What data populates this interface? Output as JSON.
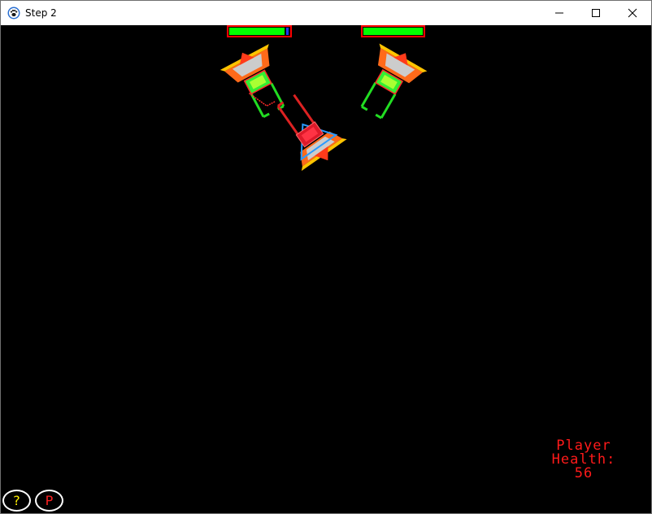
{
  "window": {
    "title": "Step 2",
    "controls": [
      "minimize",
      "maximize",
      "close"
    ]
  },
  "hud": {
    "player_health_label": "Player Health:",
    "player_health_value": "56"
  },
  "buttons": {
    "help_label": "?",
    "pause_label": "P"
  },
  "enemies": [
    {
      "health_fraction": 0.92
    },
    {
      "health_fraction": 1.0
    }
  ],
  "colors": {
    "background": "#000000",
    "health_bar_fill": "#00ff00",
    "health_bar_border": "#ff0000",
    "hud_text": "#ff1a1a",
    "help_button_text": "#ffee00",
    "pause_button_text": "#ff2020",
    "button_outline": "#ffffff"
  }
}
